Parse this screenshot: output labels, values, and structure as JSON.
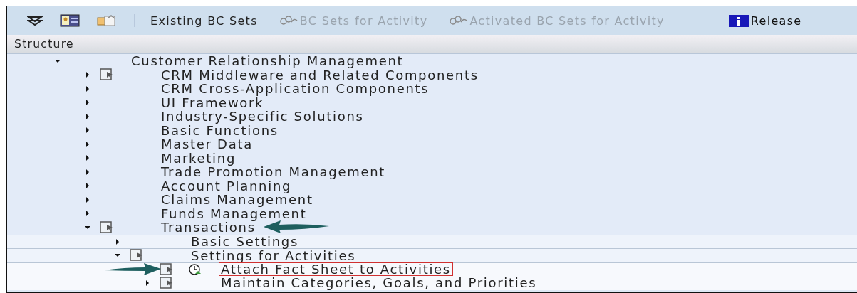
{
  "toolbar": {
    "items": [
      {
        "kind": "icon"
      },
      {
        "kind": "icon"
      },
      {
        "kind": "icon"
      },
      {
        "kind": "separator"
      },
      {
        "kind": "button",
        "label": "Existing BC Sets",
        "disabled": false
      },
      {
        "kind": "chainbutton",
        "label": "BC Sets for Activity",
        "disabled": true
      },
      {
        "kind": "chainbutton",
        "label": "Activated BC Sets for Activity",
        "disabled": true
      },
      {
        "kind": "infobutton",
        "label": "Release",
        "disabled": false
      }
    ]
  },
  "tree": {
    "header": "Structure",
    "nodes": [
      {
        "label": "Customer Relationship Management",
        "expanded": true,
        "children": [
          {
            "label": "CRM Middleware and Related Components",
            "expanded": false,
            "doc_icon": true
          },
          {
            "label": "CRM Cross-Application Components",
            "expanded": false
          },
          {
            "label": "UI Framework",
            "expanded": false
          },
          {
            "label": "Industry-Specific Solutions",
            "expanded": false
          },
          {
            "label": "Basic Functions",
            "expanded": false
          },
          {
            "label": "Master Data",
            "expanded": false
          },
          {
            "label": "Marketing",
            "expanded": false
          },
          {
            "label": "Trade Promotion Management",
            "expanded": false
          },
          {
            "label": "Account Planning",
            "expanded": false
          },
          {
            "label": "Claims Management",
            "expanded": false
          },
          {
            "label": "Funds Management",
            "expanded": false
          },
          {
            "label": "Transactions",
            "expanded": true,
            "doc_icon": true,
            "arrow_after": true,
            "children": [
              {
                "label": "Basic Settings",
                "expanded": false
              },
              {
                "label": "Settings for Activities",
                "expanded": true,
                "doc_icon": true,
                "children": [
                  {
                    "label": "Attach Fact Sheet to Activities",
                    "doc_icon": true,
                    "clock_icon": true,
                    "selected": true,
                    "arrow_before": true
                  },
                  {
                    "label": "Maintain Categories, Goals, and Priorities",
                    "expanded": false,
                    "doc_icon": true,
                    "selected": false
                  }
                ]
              }
            ]
          }
        ]
      }
    ]
  }
}
